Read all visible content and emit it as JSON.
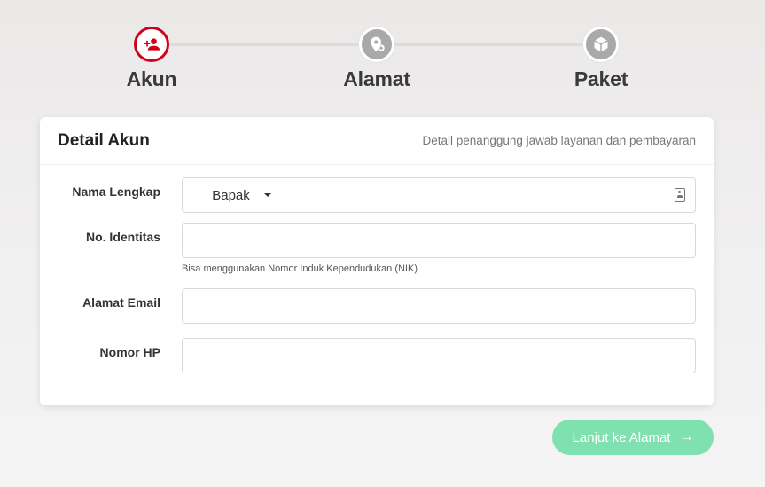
{
  "stepper": {
    "steps": [
      {
        "label": "Akun",
        "icon": "add-user-icon",
        "state": "active"
      },
      {
        "label": "Alamat",
        "icon": "location-add-icon",
        "state": "inactive"
      },
      {
        "label": "Paket",
        "icon": "box-icon",
        "state": "inactive"
      }
    ]
  },
  "card": {
    "title": "Detail Akun",
    "subtitle": "Detail penanggung jawab layanan dan pembayaran"
  },
  "form": {
    "full_name": {
      "label": "Nama Lengkap",
      "salutation": "Bapak",
      "value": "",
      "placeholder": ""
    },
    "identity": {
      "label": "No. Identitas",
      "value": "",
      "help": "Bisa menggunakan Nomor Induk Kependudukan (NIK)"
    },
    "email": {
      "label": "Alamat Email",
      "value": ""
    },
    "phone": {
      "label": "Nomor HP",
      "value": ""
    }
  },
  "actions": {
    "next_label": "Lanjut ke Alamat",
    "next_icon": "arrow-right-icon"
  },
  "colors": {
    "active_step": "#d0021b",
    "inactive_step": "#a9a9a9",
    "next_button": "#7fe0b0"
  }
}
